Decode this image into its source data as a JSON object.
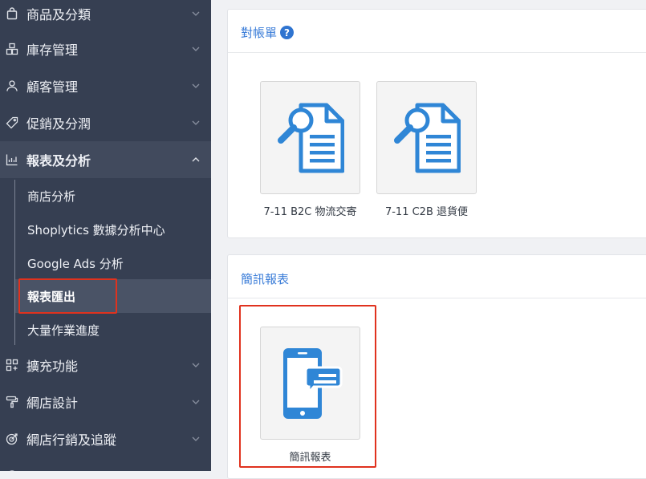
{
  "sidebar": {
    "items": [
      {
        "label": "商品及分類",
        "icon": "bag-icon"
      },
      {
        "label": "庫存管理",
        "icon": "boxes-icon"
      },
      {
        "label": "顧客管理",
        "icon": "user-icon"
      },
      {
        "label": "促銷及分潤",
        "icon": "tag-icon"
      },
      {
        "label": "報表及分析",
        "icon": "chart-icon"
      },
      {
        "label": "擴充功能",
        "icon": "apps-icon"
      },
      {
        "label": "網店設計",
        "icon": "paint-roller-icon"
      },
      {
        "label": "網店行銷及追蹤",
        "icon": "target-icon"
      }
    ],
    "subitems": [
      {
        "label": "商店分析"
      },
      {
        "label": "Shoplytics 數據分析中心"
      },
      {
        "label": "Google Ads 分析"
      },
      {
        "label": "報表匯出"
      },
      {
        "label": "大量作業進度"
      }
    ]
  },
  "main": {
    "panels": [
      {
        "title": "對帳單",
        "help_icon": "?",
        "tiles": [
          {
            "label": "7-11 B2C 物流交寄",
            "icon": "document-search-icon"
          },
          {
            "label": "7-11 C2B 退貨便",
            "icon": "document-search-icon"
          }
        ]
      },
      {
        "title": "簡訊報表",
        "tiles": [
          {
            "label": "簡訊報表",
            "icon": "phone-message-icon"
          }
        ]
      }
    ]
  },
  "colors": {
    "sidebar_bg": "#363f52",
    "accent_blue": "#2f86d6",
    "highlight_red": "#e0321e"
  }
}
